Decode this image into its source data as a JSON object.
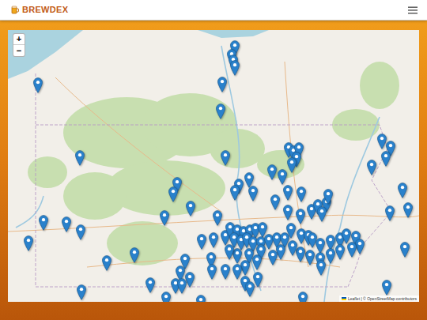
{
  "header": {
    "title": "BREWDEX"
  },
  "map": {
    "zoom_in": "+",
    "zoom_out": "−",
    "attribution": "Leaflet | © OpenStreetMap contributors",
    "pins": [
      {
        "lat": 42.63,
        "lng": -76.839
      },
      {
        "lat": 42.52,
        "lng": -76.891
      },
      {
        "lat": 42.45,
        "lng": -76.865
      },
      {
        "lat": 42.38,
        "lng": -76.839
      },
      {
        "lat": 42.17,
        "lng": -77.047
      },
      {
        "lat": 41.83,
        "lng": -77.073
      },
      {
        "lat": 42.16,
        "lng": -80.076
      },
      {
        "lat": 41.24,
        "lng": -79.387
      },
      {
        "lat": 41.24,
        "lng": -76.995
      },
      {
        "lat": 40.9,
        "lng": -77.788
      },
      {
        "lat": 40.78,
        "lng": -77.853
      },
      {
        "lat": 40.88,
        "lng": -76.774
      },
      {
        "lat": 40.8,
        "lng": -76.839
      },
      {
        "lat": 40.96,
        "lng": -76.605
      },
      {
        "lat": 40.79,
        "lng": -76.54
      },
      {
        "lat": 41.06,
        "lng": -76.228
      },
      {
        "lat": 41.0,
        "lng": -76.059
      },
      {
        "lat": 41.34,
        "lng": -75.955
      },
      {
        "lat": 41.3,
        "lng": -75.877
      },
      {
        "lat": 41.34,
        "lng": -75.786
      },
      {
        "lat": 41.22,
        "lng": -75.825
      },
      {
        "lat": 41.15,
        "lng": -75.903
      },
      {
        "lat": 40.8,
        "lng": -75.968
      },
      {
        "lat": 40.68,
        "lng": -76.176
      },
      {
        "lat": 40.78,
        "lng": -75.747
      },
      {
        "lat": 40.6,
        "lng": -77.567
      },
      {
        "lat": 40.48,
        "lng": -77.996
      },
      {
        "lat": 40.48,
        "lng": -77.125
      },
      {
        "lat": 40.42,
        "lng": -79.985
      },
      {
        "lat": 40.4,
        "lng": -79.608
      },
      {
        "lat": 40.3,
        "lng": -79.374
      },
      {
        "lat": 40.16,
        "lng": -80.232
      },
      {
        "lat": 39.91,
        "lng": -78.945
      },
      {
        "lat": 40.01,
        "lng": -78.49
      },
      {
        "lat": 40.18,
        "lng": -77.385
      },
      {
        "lat": 40.2,
        "lng": -77.19
      },
      {
        "lat": 40.23,
        "lng": -76.995
      },
      {
        "lat": 40.33,
        "lng": -76.917
      },
      {
        "lat": 40.3,
        "lng": -76.8
      },
      {
        "lat": 40.28,
        "lng": -76.696
      },
      {
        "lat": 40.3,
        "lng": -76.592
      },
      {
        "lat": 40.32,
        "lng": -76.501
      },
      {
        "lat": 40.33,
        "lng": -76.384
      },
      {
        "lat": 40.2,
        "lng": -76.852
      },
      {
        "lat": 40.17,
        "lng": -76.735
      },
      {
        "lat": 40.2,
        "lng": -76.644
      },
      {
        "lat": 40.15,
        "lng": -76.54
      },
      {
        "lat": 40.15,
        "lng": -76.41
      },
      {
        "lat": 40.18,
        "lng": -76.28
      },
      {
        "lat": 40.2,
        "lng": -76.15
      },
      {
        "lat": 40.2,
        "lng": -76.02
      },
      {
        "lat": 40.32,
        "lng": -75.916
      },
      {
        "lat": 40.25,
        "lng": -75.747
      },
      {
        "lat": 40.23,
        "lng": -75.63
      },
      {
        "lat": 40.55,
        "lng": -75.968
      },
      {
        "lat": 40.5,
        "lng": -75.76
      },
      {
        "lat": 40.56,
        "lng": -75.578
      },
      {
        "lat": 40.62,
        "lng": -75.474
      },
      {
        "lat": 40.65,
        "lng": -75.331
      },
      {
        "lat": 40.53,
        "lng": -75.409
      },
      {
        "lat": 40.75,
        "lng": -75.305
      },
      {
        "lat": 40.2,
        "lng": -75.565
      },
      {
        "lat": 40.13,
        "lng": -75.435
      },
      {
        "lat": 40.17,
        "lng": -75.266
      },
      {
        "lat": 40.2,
        "lng": -75.11
      },
      {
        "lat": 40.25,
        "lng": -75.006
      },
      {
        "lat": 40.22,
        "lng": -74.85
      },
      {
        "lat": 40.12,
        "lng": -74.785
      },
      {
        "lat": 40.08,
        "lng": -74.915
      },
      {
        "lat": 40.05,
        "lng": -75.11
      },
      {
        "lat": 40.0,
        "lng": -75.266
      },
      {
        "lat": 39.95,
        "lng": -75.435
      },
      {
        "lat": 39.98,
        "lng": -75.604
      },
      {
        "lat": 40.02,
        "lng": -75.76
      },
      {
        "lat": 40.1,
        "lng": -75.89
      },
      {
        "lat": 40.05,
        "lng": -76.085
      },
      {
        "lat": 39.98,
        "lng": -76.215
      },
      {
        "lat": 40.05,
        "lng": -76.41
      },
      {
        "lat": 40.0,
        "lng": -76.605
      },
      {
        "lat": 40.0,
        "lng": -76.8
      },
      {
        "lat": 40.05,
        "lng": -76.93
      },
      {
        "lat": 39.92,
        "lng": -76.475
      },
      {
        "lat": 39.85,
        "lng": -76.67
      },
      {
        "lat": 39.8,
        "lng": -76.8
      },
      {
        "lat": 39.8,
        "lng": -76.995
      },
      {
        "lat": 39.95,
        "lng": -77.229
      },
      {
        "lat": 39.8,
        "lng": -77.216
      },
      {
        "lat": 39.93,
        "lng": -77.658
      },
      {
        "lat": 39.78,
        "lng": -77.736
      },
      {
        "lat": 39.7,
        "lng": -77.58
      },
      {
        "lat": 39.62,
        "lng": -77.814
      },
      {
        "lat": 39.62,
        "lng": -77.71
      },
      {
        "lat": 39.63,
        "lng": -78.23
      },
      {
        "lat": 39.45,
        "lng": -77.97
      },
      {
        "lat": 39.41,
        "lng": -77.398
      },
      {
        "lat": 39.65,
        "lng": -76.67
      },
      {
        "lat": 39.58,
        "lng": -76.592
      },
      {
        "lat": 39.7,
        "lng": -76.462
      },
      {
        "lat": 39.45,
        "lng": -75.721
      },
      {
        "lat": 39.85,
        "lng": -75.422
      },
      {
        "lat": 39.6,
        "lng": -74.343
      },
      {
        "lat": 40.08,
        "lng": -74.044
      },
      {
        "lat": 40.54,
        "lng": -74.291
      },
      {
        "lat": 40.58,
        "lng": -73.992
      },
      {
        "lat": 40.83,
        "lng": -74.083
      },
      {
        "lat": 41.12,
        "lng": -74.59
      },
      {
        "lat": 41.45,
        "lng": -74.421
      },
      {
        "lat": 41.36,
        "lng": -74.278
      },
      {
        "lat": 41.23,
        "lng": -74.356
      },
      {
        "lat": 39.54,
        "lng": -79.361
      }
    ]
  }
}
